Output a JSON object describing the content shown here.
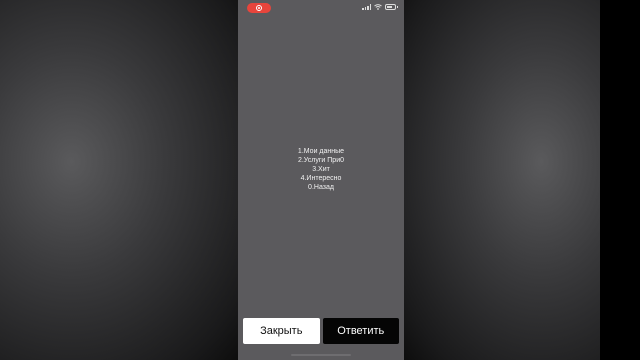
{
  "status_bar": {
    "recording_color": "#e8453c",
    "icons": [
      "screen-record-icon",
      "signal-icon",
      "wifi-icon",
      "battery-icon"
    ]
  },
  "ussd_menu": {
    "items": [
      "1.Мои данные",
      "2.Услуги При0",
      "3.Хит",
      "4.Интересно",
      "0.Назад"
    ]
  },
  "actions": {
    "close_label": "Закрыть",
    "reply_label": "Ответить"
  }
}
